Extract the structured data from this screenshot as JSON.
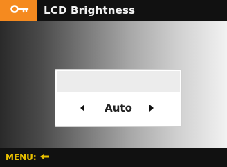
{
  "header": {
    "title": "LCD Brightness",
    "menu_icon": "settings-key-icon",
    "accent_color": "#f58a1f"
  },
  "dialog": {
    "value": "Auto",
    "left_arrow_icon": "left-arrow-icon",
    "right_arrow_icon": "right-arrow-icon"
  },
  "footer": {
    "menu_label": "MENU:",
    "menu_icon": "return-icon",
    "text_color": "#e9c000"
  }
}
